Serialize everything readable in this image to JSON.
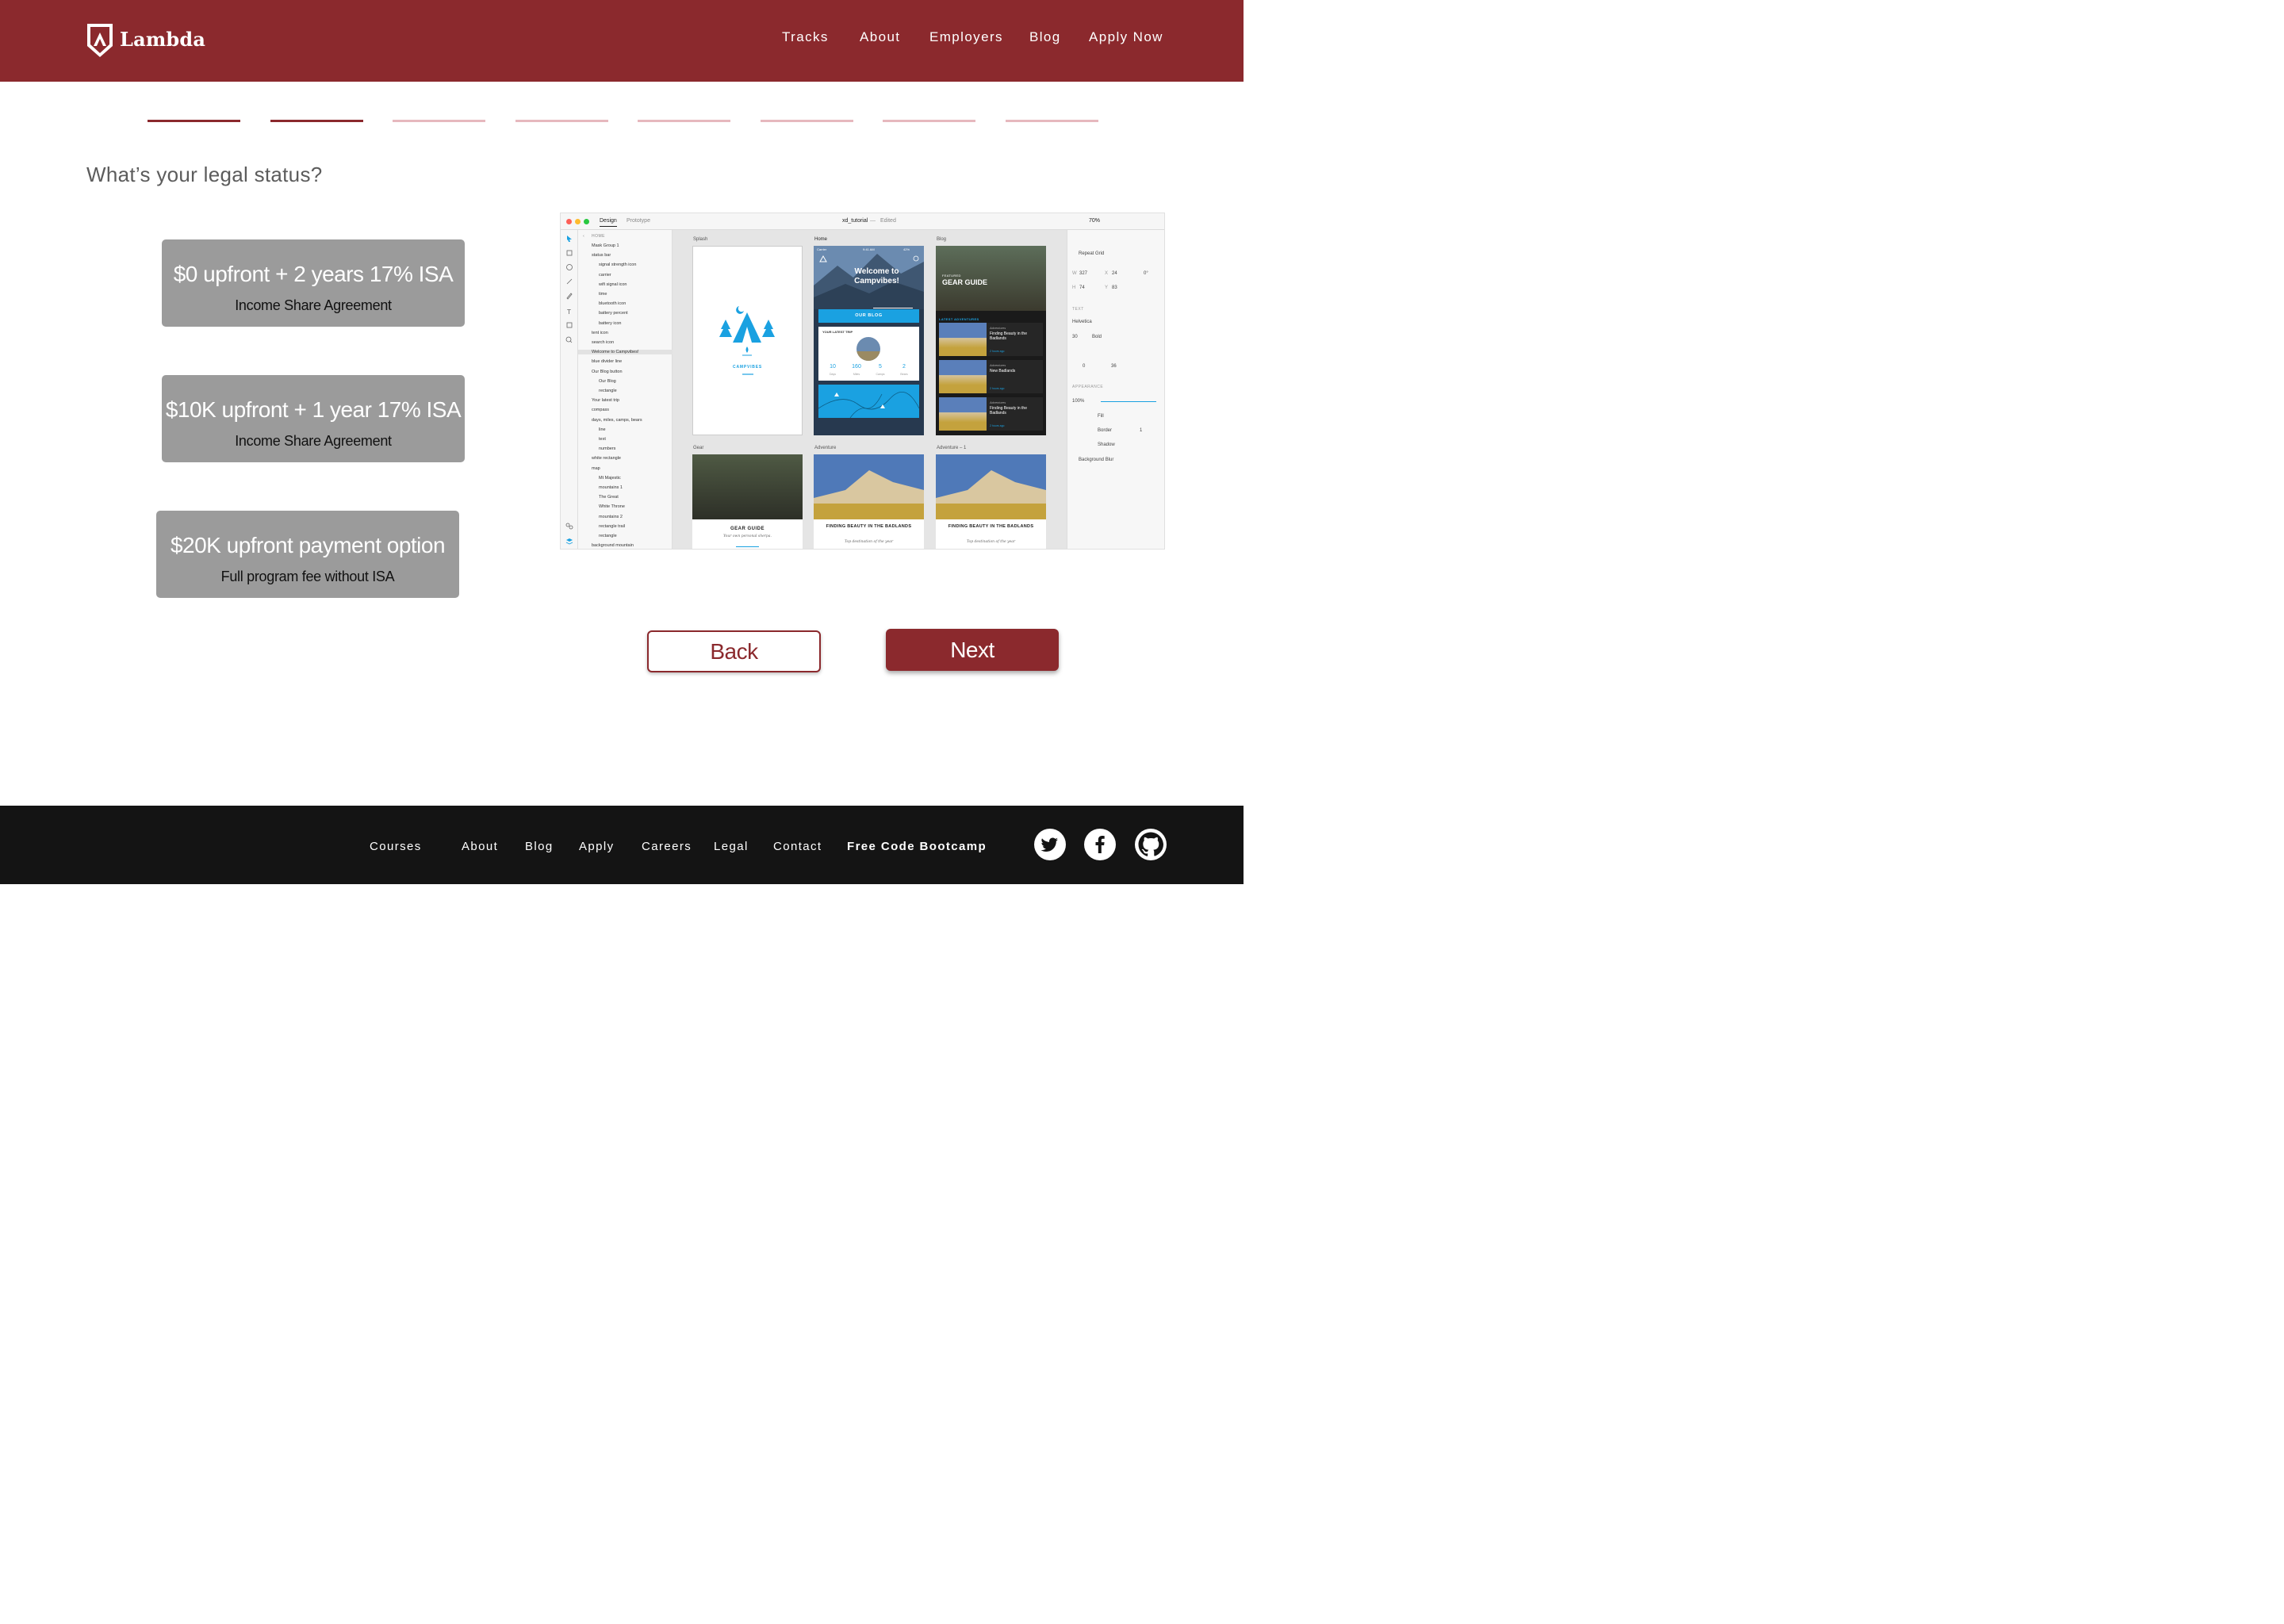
{
  "header": {
    "logo_text": "Lambda",
    "nav": [
      "Tracks",
      "About",
      "Employers",
      "Blog",
      "Apply Now"
    ]
  },
  "progress": {
    "total_steps": 8,
    "completed_steps": 2
  },
  "question": "What’s your legal status?",
  "options": [
    {
      "title": "$0 upfront + 2 years 17% ISA",
      "subtitle": "Income Share Agreement"
    },
    {
      "title": "$10K upfront + 1 year 17% ISA",
      "subtitle": "Income Share Agreement"
    },
    {
      "title": "$20K upfront payment option",
      "subtitle": "Full program fee without ISA"
    }
  ],
  "buttons": {
    "back": "Back",
    "next": "Next"
  },
  "footer": {
    "links": [
      "Courses",
      "About",
      "Blog",
      "Apply",
      "Careers",
      "Legal",
      "Contact",
      "Free Code Bootcamp"
    ],
    "social": [
      "twitter-icon",
      "facebook-icon",
      "github-icon"
    ]
  },
  "colors": {
    "brand": "#8b292d",
    "option_bg": "#9b9b9b",
    "footer_bg": "#141414",
    "progress_inactive": "#e6b8be"
  },
  "screenshot": {
    "tabs": [
      "Design",
      "Prototype"
    ],
    "doc_title": "xd_tutorial",
    "doc_status": "Edited",
    "zoom": "70%",
    "layers_header": "HOME",
    "layers": [
      "Mask Group 1",
      "status bar",
      "signal strength icon",
      "carrier",
      "wifi signal icon",
      "time",
      "bluetooth icon",
      "battery percent",
      "battery icon",
      "tent icon",
      "search icon",
      "Welcome to Campvibes!",
      "blue divider line",
      "Our Blog button",
      "Our Blog",
      "rectangle",
      "Your latest trip",
      "compass",
      "days, miles, camps, bears",
      "line",
      "text",
      "numbers",
      "white rectangle",
      "map",
      "Mt Majestic",
      "mountains 1",
      "The Great",
      "White Throne",
      "mountains 2",
      "rectangle trail",
      "rectangle",
      "background mountain"
    ],
    "artboards": [
      "Splash",
      "Home",
      "Blog",
      "Gear",
      "Adventure",
      "Adventure – 1"
    ],
    "home_title": "Welcome to Campvibes!",
    "home_button": "OUR BLOG",
    "home_trip_label": "YOUR LATEST TRIP",
    "home_stats": [
      {
        "value": "10",
        "label": "Days"
      },
      {
        "value": "160",
        "label": "Miles"
      },
      {
        "value": "5",
        "label": "Camps"
      },
      {
        "value": "2",
        "label": "Bears"
      }
    ],
    "splash_brand": "CAMPVIBES",
    "blog_feature_label": "FEATURED",
    "blog_title": "GEAR GUIDE",
    "blog_section": "LATEST ADVENTURES",
    "blog_posts": [
      {
        "category": "Adventures",
        "title": "Finding Beauty in the Badlands",
        "time": "2 hours ago"
      },
      {
        "category": "Adventures",
        "title": "New Badlands",
        "time": "2 hours ago"
      },
      {
        "category": "Adventures",
        "title": "Finding Beauty in the Badlands",
        "time": "2 hours ago"
      }
    ],
    "gear_title": "GEAR GUIDE",
    "gear_sub": "Your own personal sherpa.",
    "adv_title": "FINDING BEAUTY IN THE BADLANDS",
    "adv_sub": "Top destination of the year",
    "status_carrier": "Carrier",
    "status_time": "9:41 AM",
    "status_battery": "42%",
    "inspector": {
      "repeat_grid": "Repeat Grid",
      "w": "327",
      "x": "24",
      "rot": "0°",
      "h": "74",
      "y": "83",
      "text_header": "TEXT",
      "font": "Helvetica",
      "size": "30",
      "weight": "Bold",
      "char_spacing": "0",
      "line_spacing": "36",
      "appearance_header": "APPEARANCE",
      "opacity": "100%",
      "fill": "Fill",
      "border": "Border",
      "border_width": "1",
      "shadow": "Shadow",
      "bg_blur": "Background Blur"
    }
  }
}
